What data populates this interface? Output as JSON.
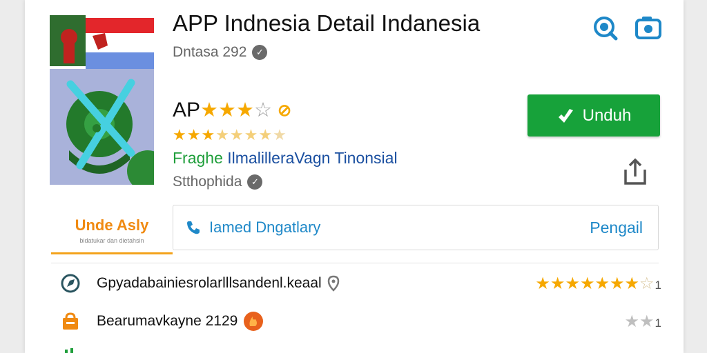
{
  "app": {
    "title": "APP Indnesia Detail Indanesia",
    "developer": "Dntasa 292",
    "rating_label": "AP",
    "stars_filled": 3,
    "stars_total": 4,
    "category_part1": "Fraghe",
    "category_part2": "IlmalilleraVagn Tinonsial",
    "subtitle": "Stthophida"
  },
  "actions": {
    "install_label": "Unduh"
  },
  "tabs": {
    "label": "Unde Asly",
    "sub": "bidatukar dan dietahsin"
  },
  "info_box": {
    "left_text": "Iamed Dngatlary",
    "right_text": "Pengail"
  },
  "list": [
    {
      "text": "Gpyadabainiesrolarlllsandenl.keaal",
      "stars_filled": 7,
      "stars_empty": 1,
      "count": "1"
    },
    {
      "text": "Bearumavkayne 2129",
      "stars_filled": 0,
      "stars_empty": 2,
      "count": "1"
    }
  ],
  "colors": {
    "accent_blue": "#1e88c8",
    "install_green": "#17a23a",
    "star_yellow": "#f6a800",
    "tab_orange": "#f08a12"
  }
}
